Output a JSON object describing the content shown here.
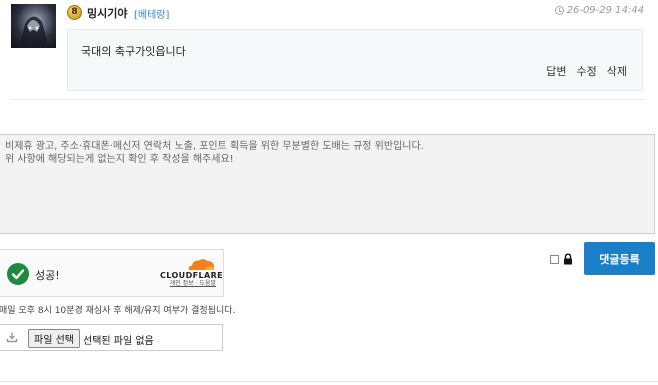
{
  "comment": {
    "level": "8",
    "nickname": "밍시기야",
    "role": "[베테랑]",
    "timestamp": "26-09-29 14:44",
    "content": "국대의 축구가잇읍니다",
    "actions": [
      "답변",
      "수정",
      "삭제"
    ]
  },
  "form": {
    "textarea_placeholder": "비제휴 광고, 주소·휴대폰·메신저 연락처 노출, 포인트 획득을 위한 무분별한 도배는 규정 위반입니다.\n위 사항에 해당되는게 없는지 확인 후 작성을 해주세요!",
    "captcha": {
      "status": "성공!",
      "brand": "CLOUDFLARE",
      "links": "개인 정보 · 도움말",
      "status_color": "#1f8a3c",
      "brand_color": "#f38020"
    },
    "submit_label": "댓글등록",
    "submit_color": "#1a7fc6",
    "notice": "매일 오후 8시 10분경 재심사 후 해제/유지 여부가 결정됩니다.",
    "file": {
      "button_label": "파일 선택",
      "status": "선택된 파일 없음"
    }
  },
  "icons": [
    "avatar",
    "level-badge",
    "clock-icon",
    "check-icon",
    "cloudflare-logo",
    "lock-icon",
    "upload-icon"
  ]
}
